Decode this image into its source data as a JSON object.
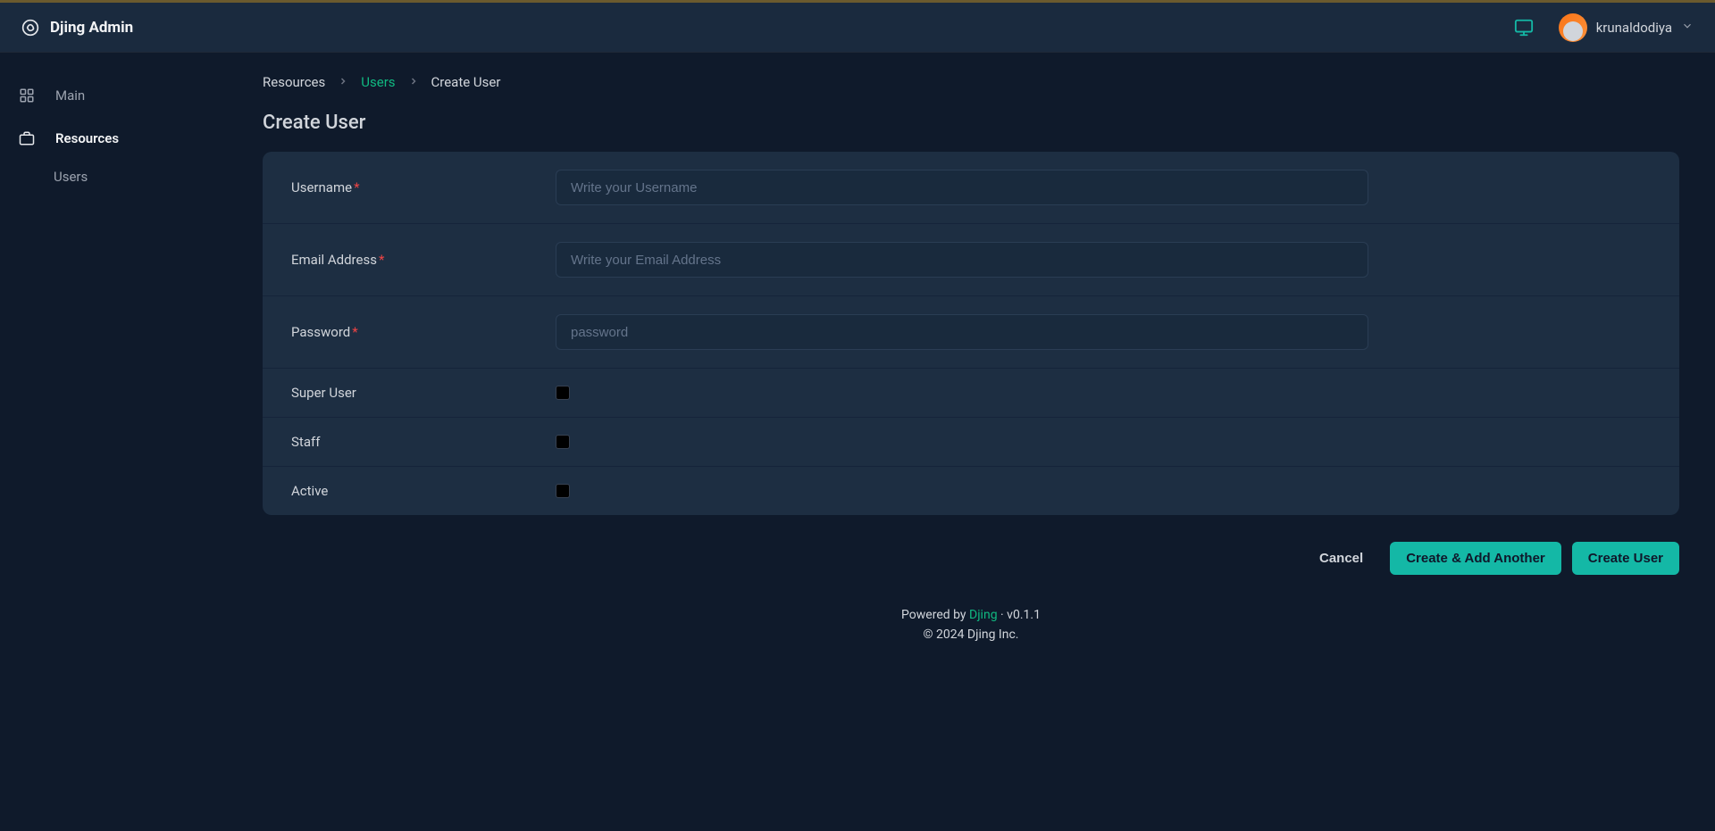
{
  "header": {
    "brand": "Djing Admin",
    "username": "krunaldodiya"
  },
  "sidebar": {
    "main_label": "Main",
    "resources_label": "Resources",
    "users_label": "Users"
  },
  "breadcrumb": {
    "resources": "Resources",
    "users": "Users",
    "create_user": "Create User"
  },
  "page": {
    "title": "Create User"
  },
  "form": {
    "username_label": "Username",
    "username_placeholder": "Write your Username",
    "email_label": "Email Address",
    "email_placeholder": "Write your Email Address",
    "password_label": "Password",
    "password_placeholder": "password",
    "super_user_label": "Super User",
    "staff_label": "Staff",
    "active_label": "Active"
  },
  "actions": {
    "cancel": "Cancel",
    "create_add_another": "Create & Add Another",
    "create_user": "Create User"
  },
  "footer": {
    "powered_by": "Powered by ",
    "link_text": "Djing",
    "version": " · v0.1.1",
    "copyright": "© 2024 Djing Inc."
  }
}
